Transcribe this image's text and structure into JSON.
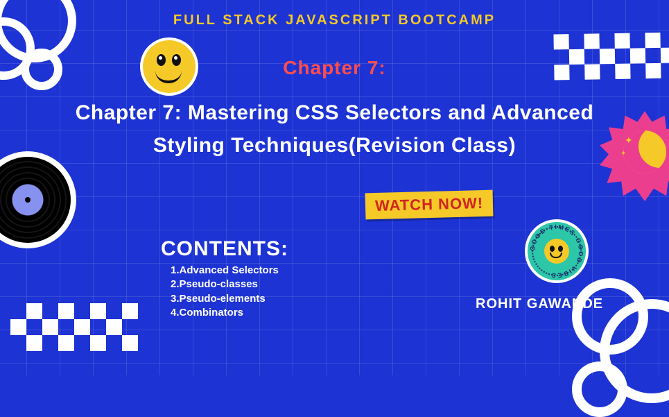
{
  "header": {
    "bootcamp_label": "FULL STACK JAVASCRIPT BOOTCAMP",
    "chapter_label": "Chapter 7:",
    "title": "Chapter 7: Mastering CSS Selectors and Advanced Styling Techniques(Revision Class)"
  },
  "cta": {
    "watch_label": "WATCH NOW!"
  },
  "contents": {
    "heading": "CONTENTS:",
    "items": [
      "1.Advanced Selectors",
      "2.Pseudo-classes",
      "3.Pseudo-elements",
      "4.Combinators"
    ]
  },
  "author": {
    "name": "ROHIT GAWANDE"
  },
  "badge": {
    "ring_text": "GOOD TIMES GOOD VIBES"
  },
  "colors": {
    "background": "#1d33d3",
    "accent_yellow": "#f5c927",
    "accent_red": "#ff4d4d",
    "cta_text": "#d22323",
    "badge_pink": "#ec3e8e",
    "badge_teal": "#2cc6a8"
  }
}
